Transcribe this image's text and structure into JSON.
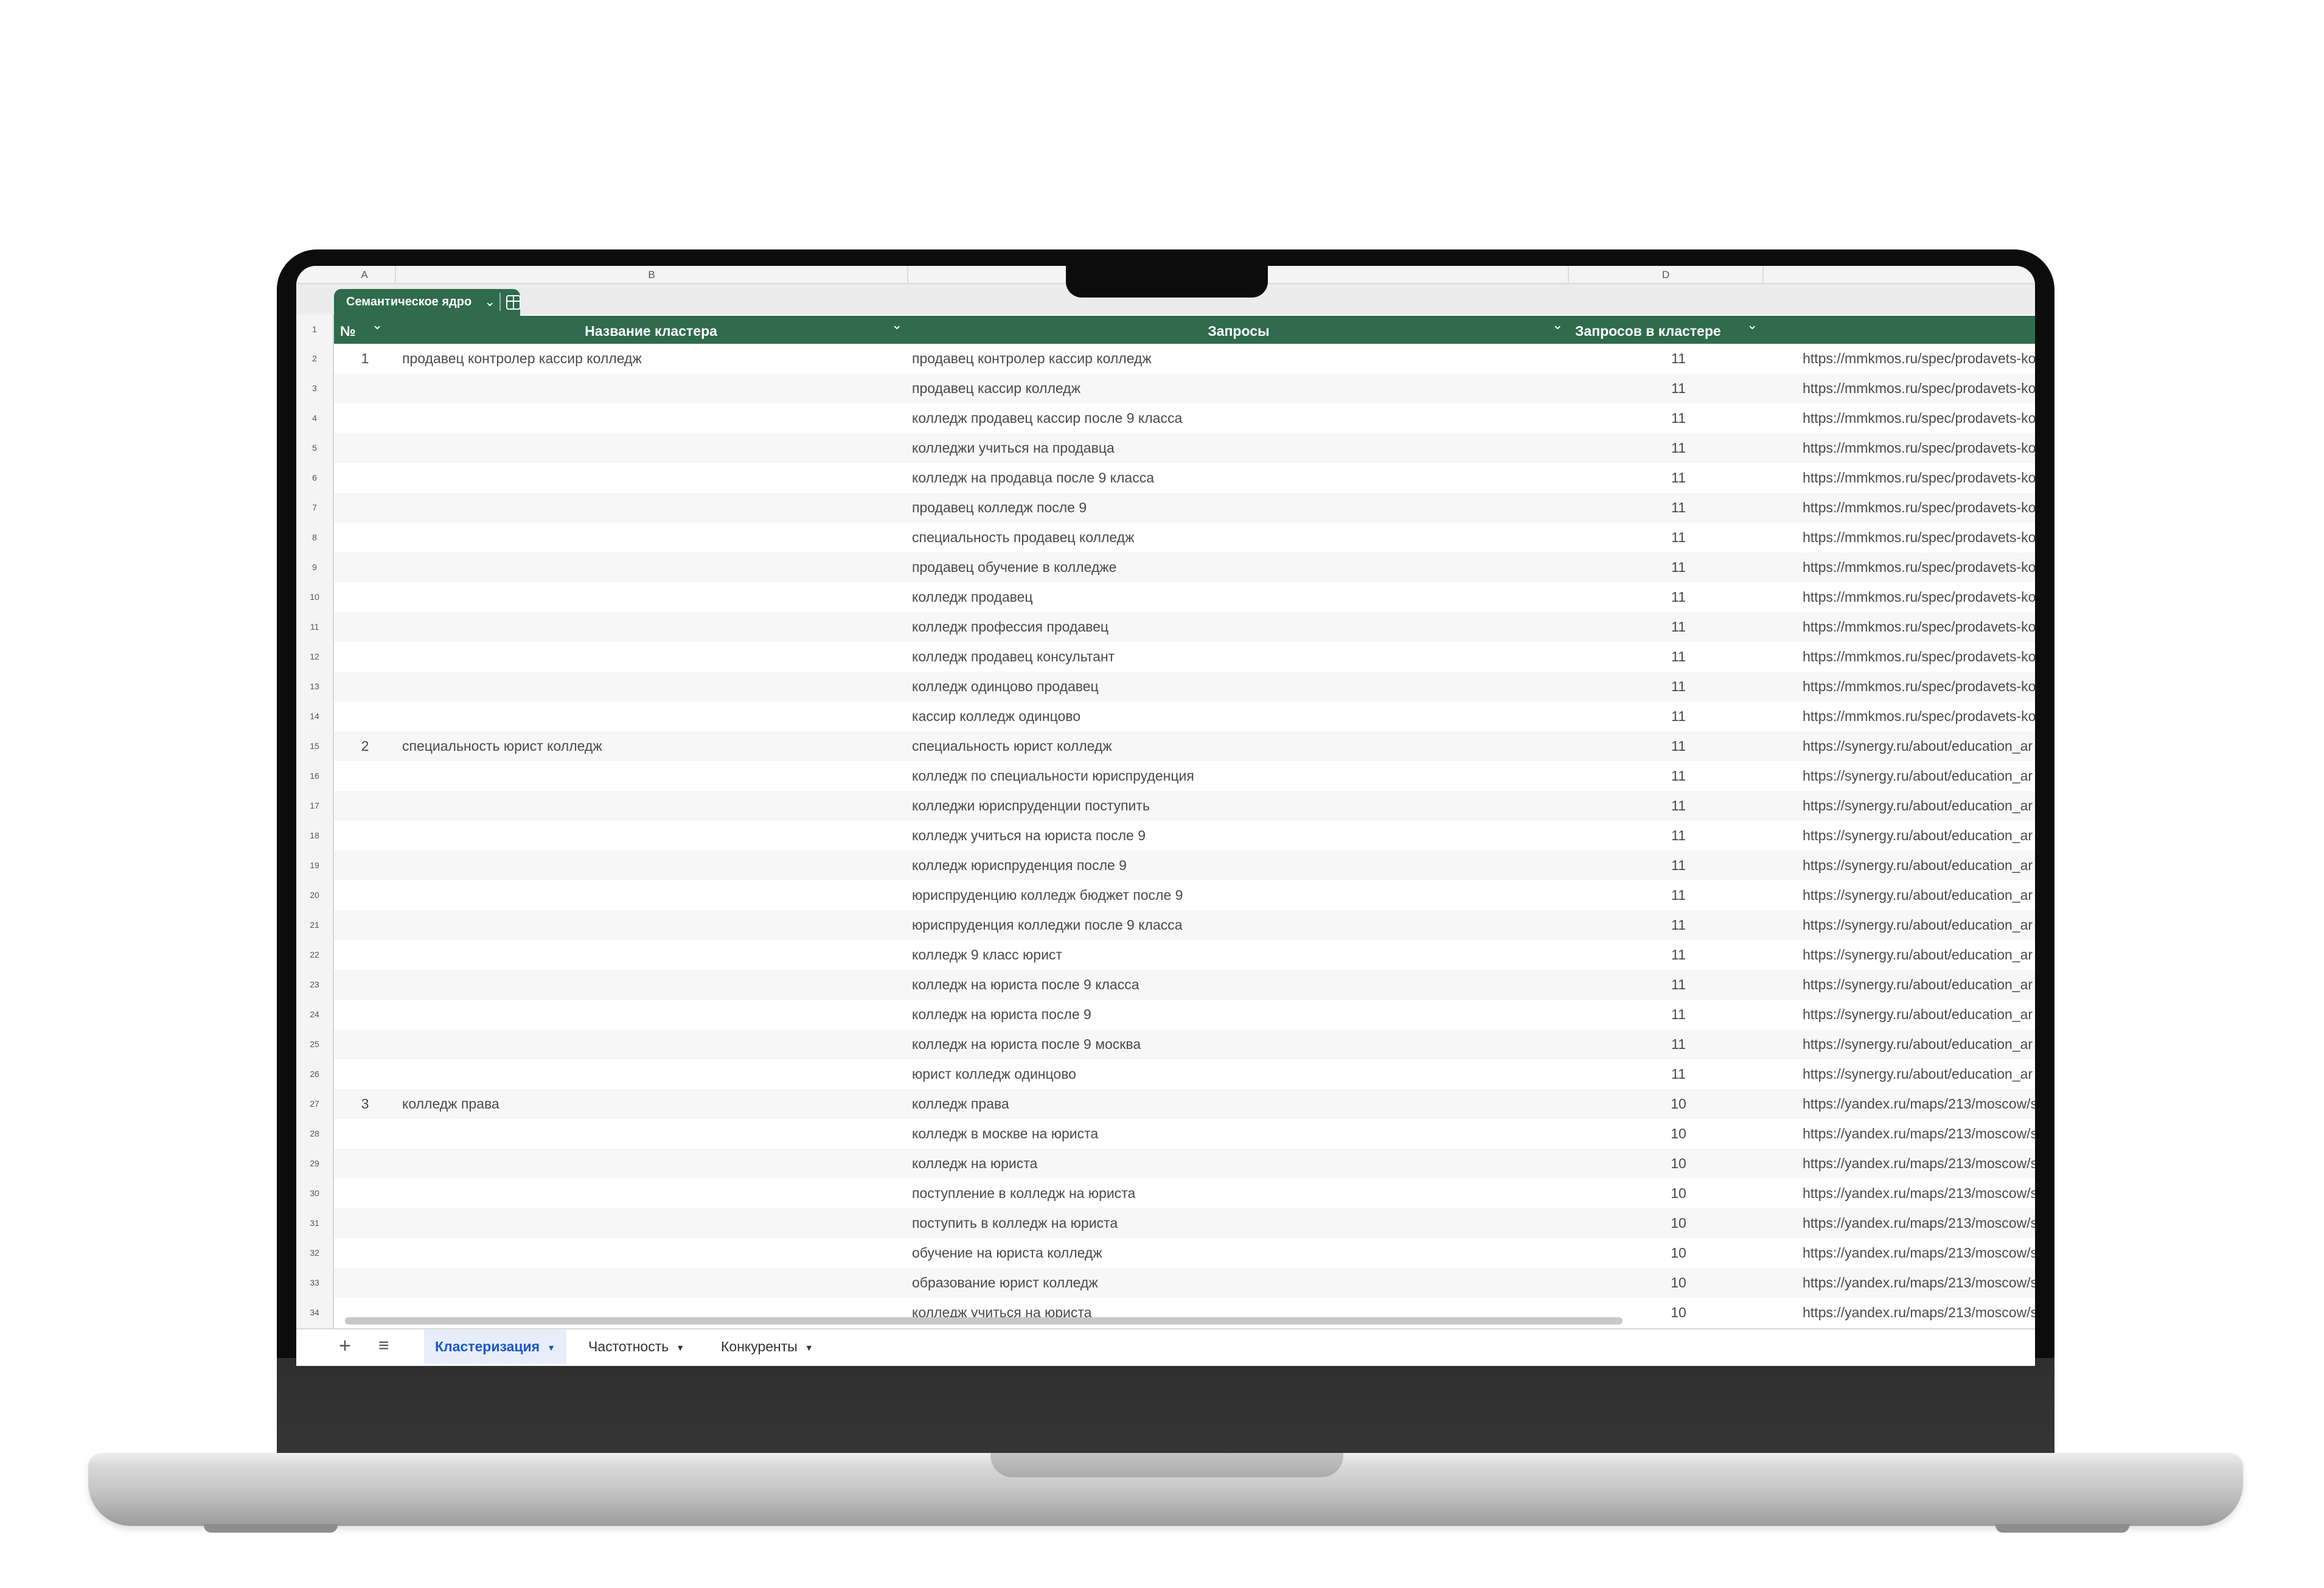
{
  "columns": {
    "a": "A",
    "b": "B",
    "d": "D"
  },
  "table_tab": {
    "label": "Семантическое ядро",
    "dropdown_icon": "chevron-down-icon",
    "view_icon": "table-icon"
  },
  "headers": {
    "num": "№",
    "name": "Название кластера",
    "queries": "Запросы",
    "count": "Запросов в кластере"
  },
  "rows": [
    {
      "n": "2",
      "num": "1",
      "name": "продавец контролер кассир колледж",
      "query": "продавец контролер кассир колледж",
      "count": "11",
      "url": "https://mmkmos.ru/spec/prodavets-ko"
    },
    {
      "n": "3",
      "num": "",
      "name": "",
      "query": "продавец кассир колледж",
      "count": "11",
      "url": "https://mmkmos.ru/spec/prodavets-ko"
    },
    {
      "n": "4",
      "num": "",
      "name": "",
      "query": "колледж продавец кассир после 9 класса",
      "count": "11",
      "url": "https://mmkmos.ru/spec/prodavets-ko"
    },
    {
      "n": "5",
      "num": "",
      "name": "",
      "query": "колледжи учиться на продавца",
      "count": "11",
      "url": "https://mmkmos.ru/spec/prodavets-ko"
    },
    {
      "n": "6",
      "num": "",
      "name": "",
      "query": "колледж на продавца после 9 класса",
      "count": "11",
      "url": "https://mmkmos.ru/spec/prodavets-ko"
    },
    {
      "n": "7",
      "num": "",
      "name": "",
      "query": "продавец колледж после 9",
      "count": "11",
      "url": "https://mmkmos.ru/spec/prodavets-ko"
    },
    {
      "n": "8",
      "num": "",
      "name": "",
      "query": "специальность продавец колледж",
      "count": "11",
      "url": "https://mmkmos.ru/spec/prodavets-ko"
    },
    {
      "n": "9",
      "num": "",
      "name": "",
      "query": "продавец обучение в колледже",
      "count": "11",
      "url": "https://mmkmos.ru/spec/prodavets-ko"
    },
    {
      "n": "10",
      "num": "",
      "name": "",
      "query": "колледж продавец",
      "count": "11",
      "url": "https://mmkmos.ru/spec/prodavets-ko"
    },
    {
      "n": "11",
      "num": "",
      "name": "",
      "query": "колледж профессия продавец",
      "count": "11",
      "url": "https://mmkmos.ru/spec/prodavets-ko"
    },
    {
      "n": "12",
      "num": "",
      "name": "",
      "query": "колледж продавец консультант",
      "count": "11",
      "url": "https://mmkmos.ru/spec/prodavets-ko"
    },
    {
      "n": "13",
      "num": "",
      "name": "",
      "query": "колледж одинцово продавец",
      "count": "11",
      "url": "https://mmkmos.ru/spec/prodavets-ko"
    },
    {
      "n": "14",
      "num": "",
      "name": "",
      "query": "кассир колледж одинцово",
      "count": "11",
      "url": "https://mmkmos.ru/spec/prodavets-ko"
    },
    {
      "n": "15",
      "num": "2",
      "name": "специальность юрист колледж",
      "query": "специальность юрист колледж",
      "count": "11",
      "url": "https://synergy.ru/about/education_ar"
    },
    {
      "n": "16",
      "num": "",
      "name": "",
      "query": "колледж по специальности юриспруденция",
      "count": "11",
      "url": "https://synergy.ru/about/education_ar"
    },
    {
      "n": "17",
      "num": "",
      "name": "",
      "query": "колледжи юриспруденции поступить",
      "count": "11",
      "url": "https://synergy.ru/about/education_ar"
    },
    {
      "n": "18",
      "num": "",
      "name": "",
      "query": "колледж учиться на юриста после 9",
      "count": "11",
      "url": "https://synergy.ru/about/education_ar"
    },
    {
      "n": "19",
      "num": "",
      "name": "",
      "query": "колледж юриспруденция после 9",
      "count": "11",
      "url": "https://synergy.ru/about/education_ar"
    },
    {
      "n": "20",
      "num": "",
      "name": "",
      "query": "юриспруденцию колледж бюджет после 9",
      "count": "11",
      "url": "https://synergy.ru/about/education_ar"
    },
    {
      "n": "21",
      "num": "",
      "name": "",
      "query": "юриспруденция колледжи после 9 класса",
      "count": "11",
      "url": "https://synergy.ru/about/education_ar"
    },
    {
      "n": "22",
      "num": "",
      "name": "",
      "query": "колледж 9 класс юрист",
      "count": "11",
      "url": "https://synergy.ru/about/education_ar"
    },
    {
      "n": "23",
      "num": "",
      "name": "",
      "query": "колледж на юриста после 9 класса",
      "count": "11",
      "url": "https://synergy.ru/about/education_ar"
    },
    {
      "n": "24",
      "num": "",
      "name": "",
      "query": "колледж на юриста после 9",
      "count": "11",
      "url": "https://synergy.ru/about/education_ar"
    },
    {
      "n": "25",
      "num": "",
      "name": "",
      "query": "колледж на юриста после 9 москва",
      "count": "11",
      "url": "https://synergy.ru/about/education_ar"
    },
    {
      "n": "26",
      "num": "",
      "name": "",
      "query": "юрист колледж одинцово",
      "count": "11",
      "url": "https://synergy.ru/about/education_ar"
    },
    {
      "n": "27",
      "num": "3",
      "name": "колледж права",
      "query": "колледж права",
      "count": "10",
      "url": "https://yandex.ru/maps/213/moscow/s"
    },
    {
      "n": "28",
      "num": "",
      "name": "",
      "query": "колледж в москве на юриста",
      "count": "10",
      "url": "https://yandex.ru/maps/213/moscow/s"
    },
    {
      "n": "29",
      "num": "",
      "name": "",
      "query": "колледж на юриста",
      "count": "10",
      "url": "https://yandex.ru/maps/213/moscow/s"
    },
    {
      "n": "30",
      "num": "",
      "name": "",
      "query": "поступление в колледж на юриста",
      "count": "10",
      "url": "https://yandex.ru/maps/213/moscow/s"
    },
    {
      "n": "31",
      "num": "",
      "name": "",
      "query": "поступить в колледж на юриста",
      "count": "10",
      "url": "https://yandex.ru/maps/213/moscow/s"
    },
    {
      "n": "32",
      "num": "",
      "name": "",
      "query": "обучение на юриста колледж",
      "count": "10",
      "url": "https://yandex.ru/maps/213/moscow/s"
    },
    {
      "n": "33",
      "num": "",
      "name": "",
      "query": "образование юрист колледж",
      "count": "10",
      "url": "https://yandex.ru/maps/213/moscow/s"
    },
    {
      "n": "34",
      "num": "",
      "name": "",
      "query": "колледж учиться на юриста",
      "count": "10",
      "url": "https://yandex.ru/maps/213/moscow/s"
    }
  ],
  "sheet_bar": {
    "add_icon": "plus-icon",
    "menu_icon": "list-icon",
    "tabs": [
      {
        "label": "Кластеризация",
        "active": true
      },
      {
        "label": "Частотность",
        "active": false
      },
      {
        "label": "Конкуренты",
        "active": false
      }
    ]
  },
  "colors": {
    "header_green": "#2f6b4c",
    "active_tab_text": "#1a56c8",
    "laptop_silver": "#c3c3c3"
  }
}
